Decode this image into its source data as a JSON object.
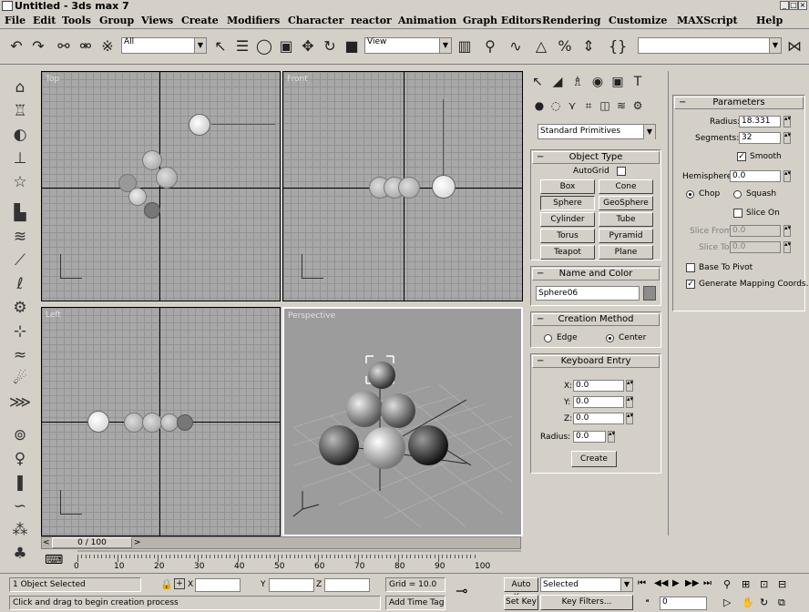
{
  "window": {
    "title": "Untitled - 3ds max 7"
  },
  "menu": [
    "File",
    "Edit",
    "Tools",
    "Group",
    "Views",
    "Create",
    "Modifiers",
    "Character",
    "reactor",
    "Animation",
    "Graph Editors",
    "Rendering",
    "Customize",
    "MAXScript",
    "Help"
  ],
  "toolbar": {
    "filter": "All",
    "refsys": "View"
  },
  "viewports": {
    "top": "Top",
    "front": "Front",
    "left": "Left",
    "perspective": "Perspective"
  },
  "create_panel": {
    "category": "Standard Primitives",
    "object_type": {
      "title": "Object Type",
      "autogrid": "AutoGrid",
      "buttons": [
        "Box",
        "Cone",
        "Sphere",
        "GeoSphere",
        "Cylinder",
        "Tube",
        "Torus",
        "Pyramid",
        "Teapot",
        "Plane"
      ]
    },
    "name_color": {
      "title": "Name and Color",
      "name": "Sphere06"
    },
    "creation_method": {
      "title": "Creation Method",
      "edge": "Edge",
      "center": "Center"
    },
    "keyboard_entry": {
      "title": "Keyboard Entry",
      "x_label": "X:",
      "y_label": "Y:",
      "z_label": "Z:",
      "radius_label": "Radius:",
      "x": "0.0",
      "y": "0.0",
      "z": "0.0",
      "radius": "0.0",
      "create": "Create"
    }
  },
  "parameters": {
    "title": "Parameters",
    "radius_label": "Radius:",
    "radius": "18.331",
    "segments_label": "Segments:",
    "segments": "32",
    "smooth": "Smooth",
    "hemisphere_label": "Hemisphere:",
    "hemisphere": "0.0",
    "chop": "Chop",
    "squash": "Squash",
    "slice_on": "Slice On",
    "slice_from_label": "Slice From:",
    "slice_from": "0.0",
    "slice_to_label": "Slice To:",
    "slice_to": "0.0",
    "base_to_pivot": "Base To Pivot",
    "gen_mapping": "Generate Mapping Coords."
  },
  "timeline": {
    "slider": "0 / 100",
    "ticks": [
      "0",
      "10",
      "20",
      "30",
      "40",
      "50",
      "60",
      "70",
      "80",
      "90",
      "100"
    ]
  },
  "status": {
    "selected": "1 Object Selected",
    "prompt": "Click and drag to begin creation process",
    "x_label": "X",
    "y_label": "Y",
    "z_label": "Z",
    "grid": "Grid = 10.0",
    "add_time_tag": "Add Time Tag",
    "auto_key": "Auto Key",
    "set_key": "Set Key",
    "selected_set": "Selected",
    "key_filters": "Key Filters...",
    "frame": "0"
  }
}
